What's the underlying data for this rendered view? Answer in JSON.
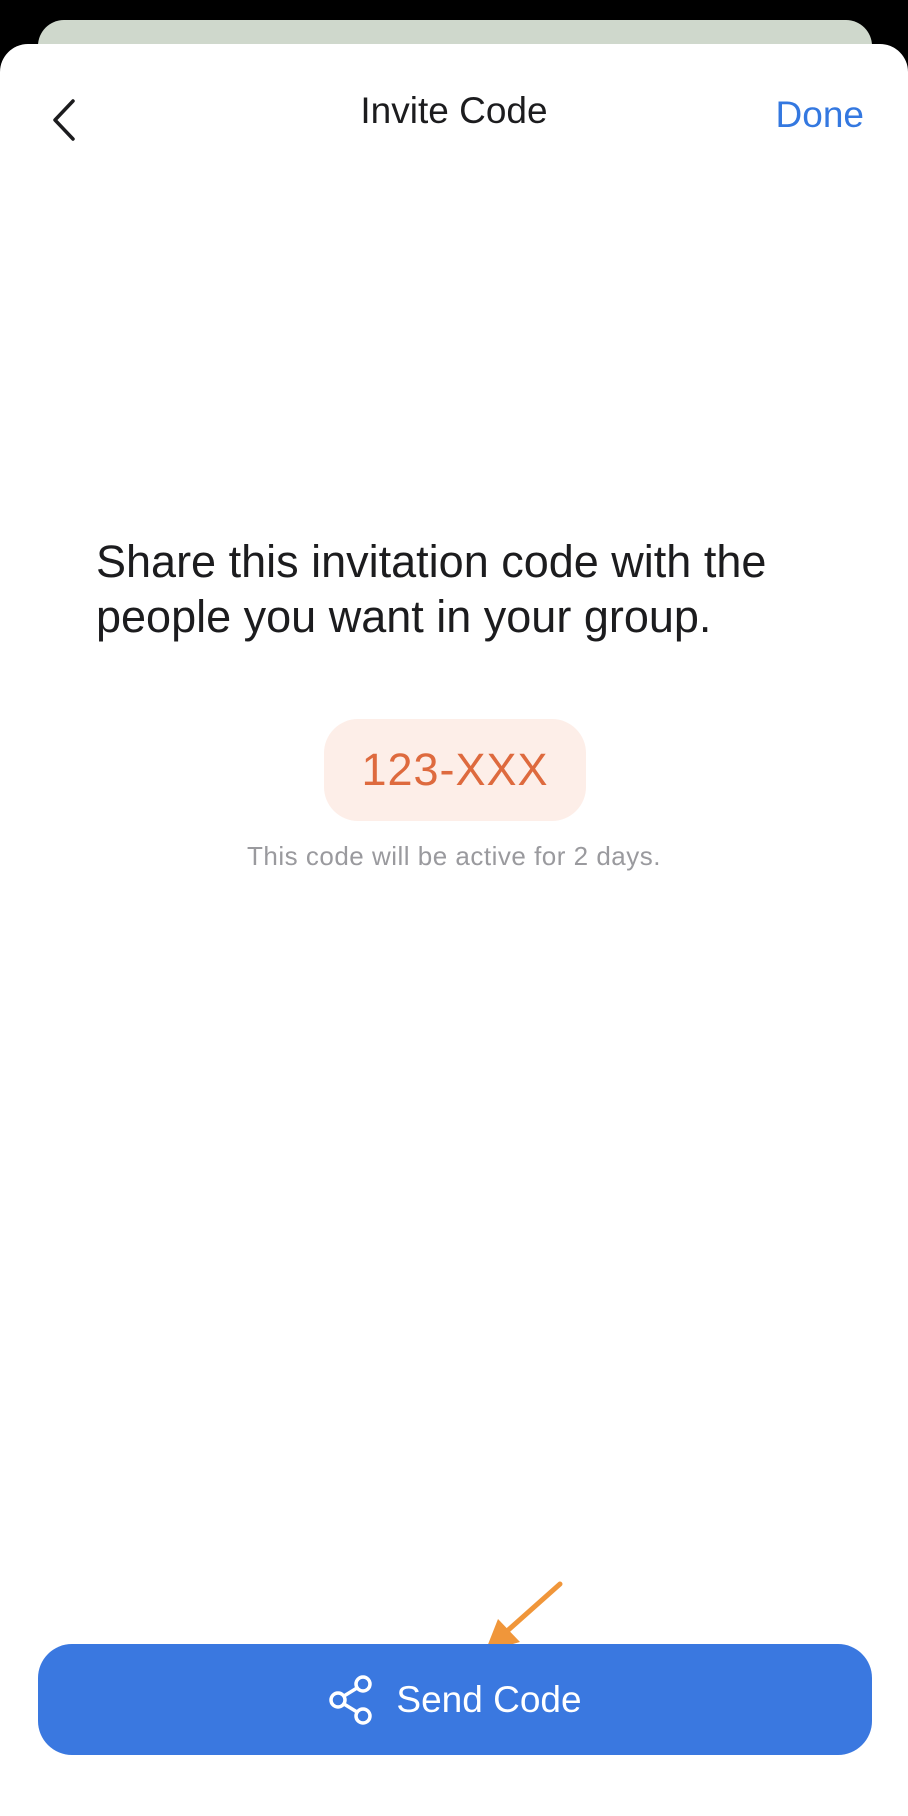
{
  "nav": {
    "title": "Invite Code",
    "done_label": "Done",
    "back_icon": "chevron-left-icon"
  },
  "main": {
    "instruction": "Share this invitation code with the people you want in your group.",
    "code": "123-XXX",
    "expiry_note": "This code will be active for 2 days."
  },
  "footer": {
    "send_label": "Send Code",
    "send_icon": "share-icon"
  },
  "colors": {
    "accent": "#3a78e0",
    "code_text": "#de6a3e",
    "code_background": "#fdeee8",
    "annotation_arrow": "#f0963a"
  }
}
